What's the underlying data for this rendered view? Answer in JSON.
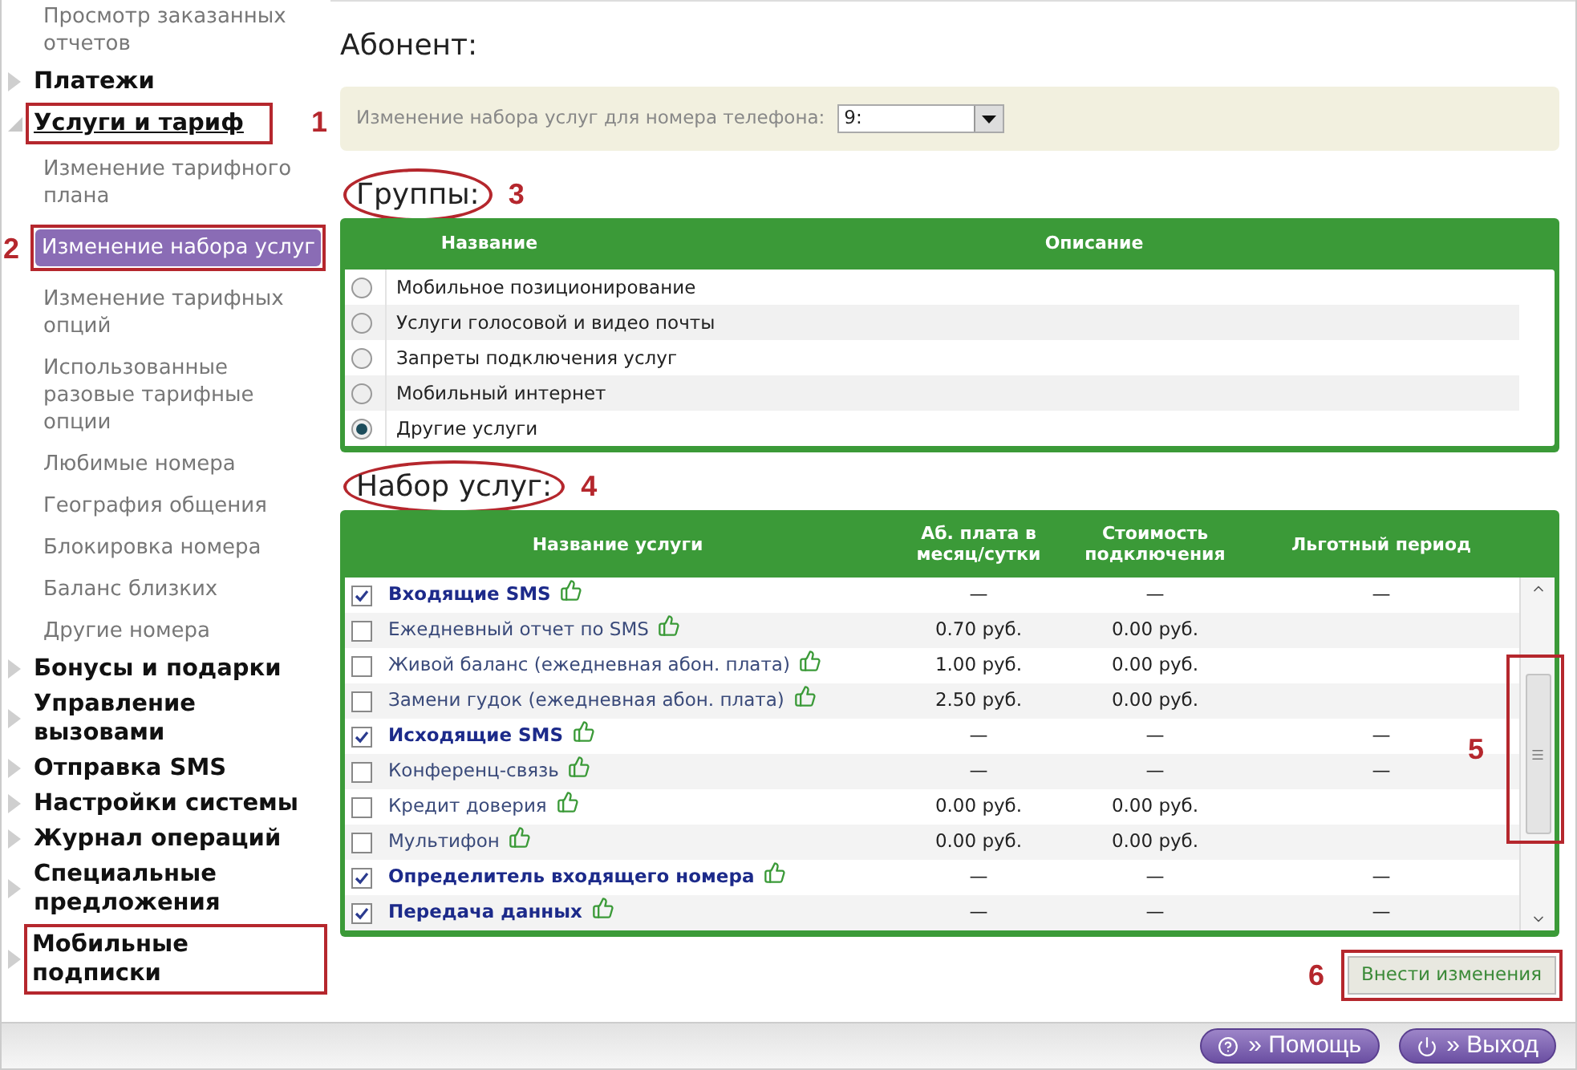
{
  "sidebar": {
    "top_children": [
      {
        "label": "Просмотр заказанных отчетов",
        "selected": false
      }
    ],
    "sections": [
      {
        "label": "Платежи",
        "expanded": false,
        "marked": false
      },
      {
        "label": "Услуги и тариф",
        "expanded": true,
        "marked": true,
        "annotation": "1",
        "children": [
          {
            "label": "Изменение тарифного плана",
            "selected": false,
            "marked": false
          },
          {
            "label": "Изменение набора услуг",
            "selected": true,
            "marked": true,
            "annotation": "2"
          },
          {
            "label": "Изменение тарифных опций",
            "selected": false,
            "marked": false
          },
          {
            "label": "Использованные разовые тарифные опции",
            "selected": false,
            "marked": false
          },
          {
            "label": "Любимые номера",
            "selected": false,
            "marked": false
          },
          {
            "label": "География общения",
            "selected": false,
            "marked": false
          },
          {
            "label": "Блокировка номера",
            "selected": false,
            "marked": false
          },
          {
            "label": "Баланс близких",
            "selected": false,
            "marked": false
          },
          {
            "label": "Другие номера",
            "selected": false,
            "marked": false
          }
        ]
      },
      {
        "label": "Бонусы и подарки",
        "expanded": false,
        "marked": false
      },
      {
        "label": "Управление вызовами",
        "expanded": false,
        "marked": false
      },
      {
        "label": "Отправка SMS",
        "expanded": false,
        "marked": false
      },
      {
        "label": "Настройки системы",
        "expanded": false,
        "marked": false
      },
      {
        "label": "Журнал операций",
        "expanded": false,
        "marked": false
      },
      {
        "label": "Специальные предложения",
        "expanded": false,
        "marked": false
      },
      {
        "label": "Мобильные подписки",
        "expanded": false,
        "marked": true
      }
    ]
  },
  "subscriber": {
    "title": "Абонент:",
    "phone_label": "Изменение набора услуг для номера телефона:",
    "phone_value": "9:"
  },
  "groups": {
    "title": "Группы:",
    "annotation": "3",
    "columns": [
      "Название",
      "Описание"
    ],
    "rows": [
      {
        "name": "Мобильное позиционирование",
        "selected": false
      },
      {
        "name": "Услуги голосовой и видео почты",
        "selected": false
      },
      {
        "name": "Запреты подключения услуг",
        "selected": false
      },
      {
        "name": "Мобильный интернет",
        "selected": false
      },
      {
        "name": "Другие услуги",
        "selected": true
      }
    ]
  },
  "services": {
    "title": "Набор услуг:",
    "annotation": "4",
    "scrollbar_annotation": "5",
    "columns": [
      "Название услуги",
      "Аб. плата в месяц/сутки",
      "Стоимость подключения",
      "Льготный период"
    ],
    "rows": [
      {
        "name": "Входящие SMS",
        "checked": true,
        "fee": "—",
        "cost": "—",
        "grace": "—"
      },
      {
        "name": "Ежедневный отчет по SMS",
        "checked": false,
        "fee": "0.70 руб.",
        "cost": "0.00 руб."
      },
      {
        "name": "Живой баланс (ежедневная абон. плата)",
        "checked": false,
        "fee": "1.00 руб.",
        "cost": "0.00 руб."
      },
      {
        "name": "Замени гудок (ежедневная абон. плата)",
        "checked": false,
        "fee": "2.50 руб.",
        "cost": "0.00 руб."
      },
      {
        "name": "Исходящие SMS",
        "checked": true,
        "fee": "—",
        "cost": "—",
        "grace": "—"
      },
      {
        "name": "Конференц-связь",
        "checked": false,
        "fee": "—",
        "cost": "—",
        "grace": "—"
      },
      {
        "name": "Кредит доверия",
        "checked": false,
        "fee": "0.00 руб.",
        "cost": "0.00 руб."
      },
      {
        "name": "Мультифон",
        "checked": false,
        "fee": "0.00 руб.",
        "cost": "0.00 руб."
      },
      {
        "name": "Определитель входящего номера",
        "checked": true,
        "fee": "—",
        "cost": "—",
        "grace": "—"
      },
      {
        "name": "Передача данных",
        "checked": true,
        "fee": "—",
        "cost": "—",
        "grace": "—"
      }
    ]
  },
  "submit": {
    "label": "Внести изменения",
    "annotation": "6"
  },
  "footer_buttons": [
    {
      "kind": "help",
      "label": "» Помощь"
    },
    {
      "kind": "exit",
      "label": "» Выход"
    }
  ]
}
